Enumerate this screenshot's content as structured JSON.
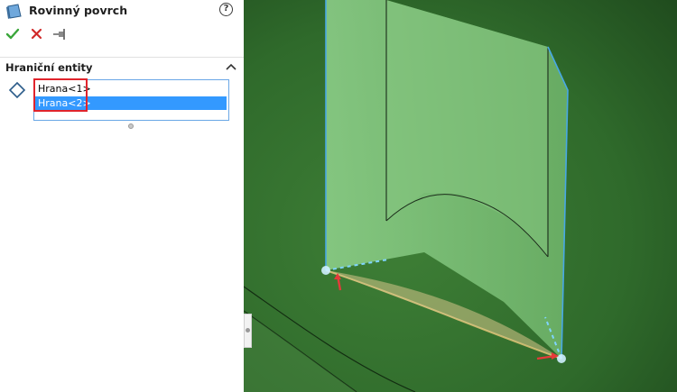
{
  "panel": {
    "title": "Rovinný povrch",
    "help_label": "?"
  },
  "toolbar": {
    "ok": "ok-icon",
    "cancel": "cancel-icon",
    "pin": "pin-icon"
  },
  "section": {
    "title": "Hraniční entity"
  },
  "entities": {
    "items": [
      {
        "label": "Hrana<1>"
      },
      {
        "label": "Hrana<2>"
      }
    ],
    "selected_index": 1
  },
  "colors": {
    "selection": "#3399ff",
    "highlight": "#e0242c",
    "model_background": "#2f6d2a",
    "surface": "#8fd28a"
  }
}
